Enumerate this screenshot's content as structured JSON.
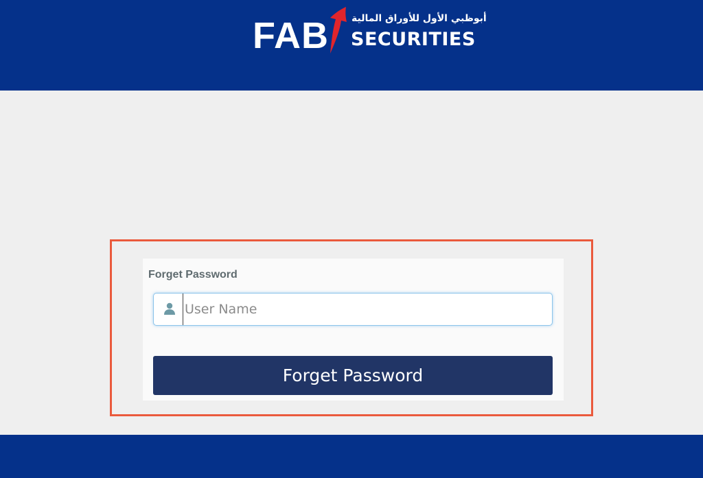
{
  "header": {
    "logo_fab": "FAB",
    "logo_arabic": "أبوظبي الأول للأوراق المالية",
    "logo_securities": "SECURITIES",
    "mark_icon": "fab-arrow-mark-icon"
  },
  "form": {
    "title": "Forget Password",
    "username": {
      "placeholder": "User Name",
      "value": "",
      "icon": "user-icon"
    },
    "submit_label": "Forget Password"
  },
  "colors": {
    "brand_blue": "#05318a",
    "button_navy": "#213566",
    "highlight": "#ea5a3c",
    "logo_accent": "#e0252c"
  }
}
